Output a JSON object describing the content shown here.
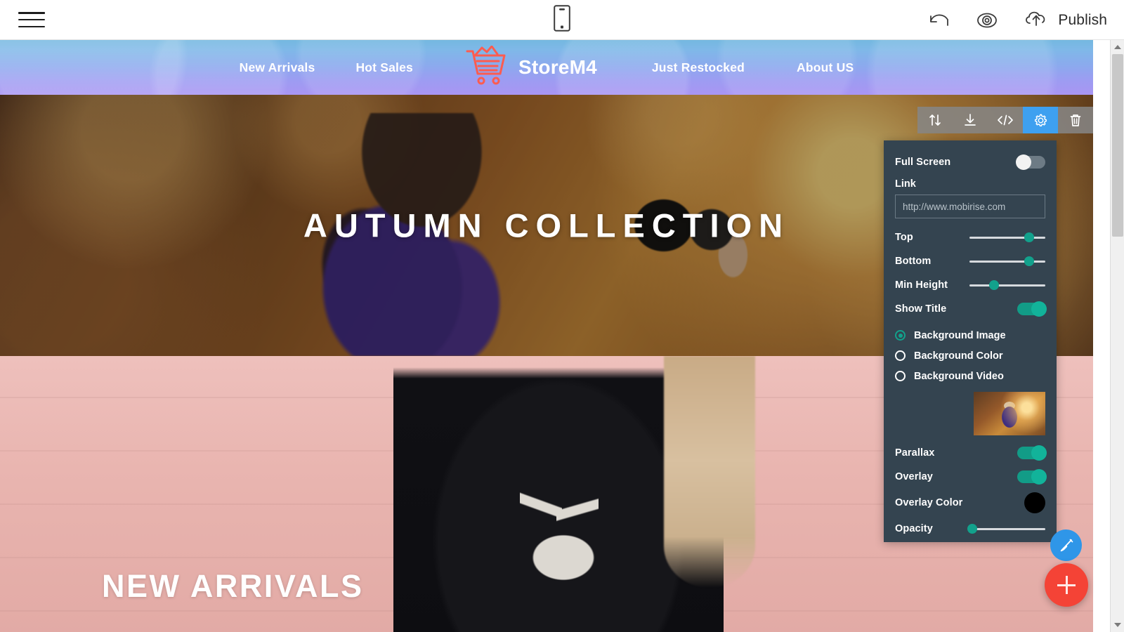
{
  "topbar": {
    "menu_icon": "hamburger-icon",
    "device_preview_icon": "mobile-phone-icon",
    "undo_icon": "undo-arrow-icon",
    "preview_icon": "eye-icon",
    "publish_icon": "cloud-upload-icon",
    "publish_label": "Publish"
  },
  "site_nav": {
    "brand_name": "StoreM4",
    "brand_icon": "shopping-cart-icon",
    "links_left": [
      {
        "label": "New Arrivals"
      },
      {
        "label": "Hot Sales"
      }
    ],
    "links_right": [
      {
        "label": "Just Restocked"
      },
      {
        "label": "About US"
      }
    ]
  },
  "hero": {
    "title": "AUTUMN COLLECTION"
  },
  "arrivals": {
    "title": "NEW ARRIVALS"
  },
  "block_toolbar": {
    "items": [
      {
        "name": "move-block-icon",
        "label": "Move Block",
        "active": false
      },
      {
        "name": "download-block-icon",
        "label": "Save Block",
        "active": false
      },
      {
        "name": "code-editor-icon",
        "label": "Edit Code",
        "active": false
      },
      {
        "name": "gear-settings-icon",
        "label": "Block Parameters",
        "active": true
      },
      {
        "name": "trash-delete-icon",
        "label": "Delete Block",
        "active": false
      }
    ]
  },
  "settings_panel": {
    "full_screen": {
      "label": "Full Screen",
      "value": "off"
    },
    "link": {
      "label": "Link",
      "placeholder": "http://www.mobirise.com",
      "value": ""
    },
    "sliders": [
      {
        "label": "Top",
        "percent": 79
      },
      {
        "label": "Bottom",
        "percent": 79
      },
      {
        "label": "Min Height",
        "percent": 32
      }
    ],
    "show_title": {
      "label": "Show Title",
      "value": "on"
    },
    "background_options": [
      {
        "label": "Background Image",
        "selected": true
      },
      {
        "label": "Background Color",
        "selected": false
      },
      {
        "label": "Background Video",
        "selected": false
      }
    ],
    "thumbnail_name": "background-image-thumbnail",
    "parallax": {
      "label": "Parallax",
      "value": "on"
    },
    "overlay": {
      "label": "Overlay",
      "value": "on"
    },
    "overlay_color": {
      "label": "Overlay Color",
      "value": "#000000"
    },
    "opacity": {
      "label": "Opacity",
      "percent": 4
    }
  },
  "fabs": {
    "brush_icon": "paintbrush-icon",
    "add_icon": "plus-icon"
  },
  "colors": {
    "accent_teal": "#1ba39c",
    "toolbar_active_blue": "#3ea0f0",
    "fab_red": "#f44336",
    "fab_blue": "#2f96e8",
    "panel_bg": "#344450",
    "brand_red": "#fd5c50"
  }
}
